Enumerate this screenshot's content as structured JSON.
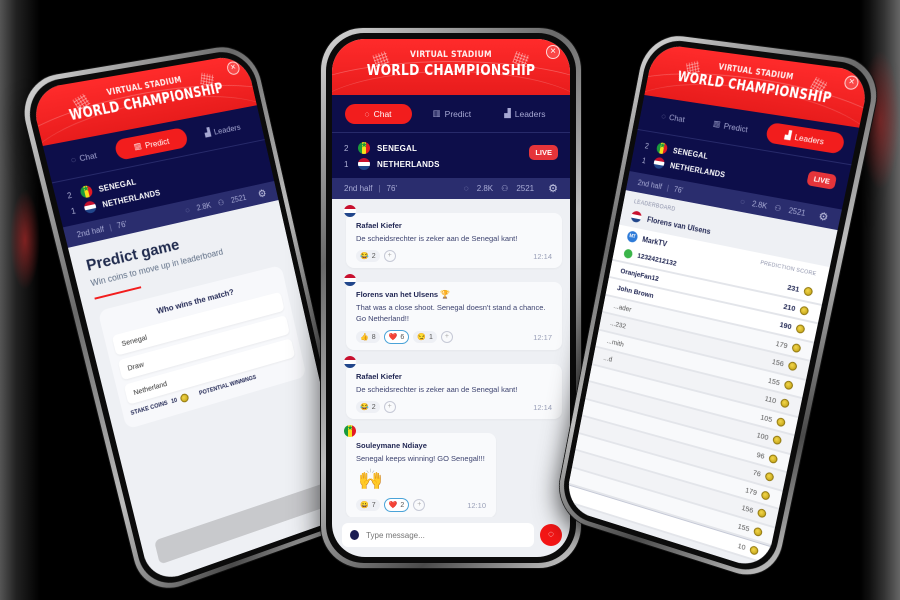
{
  "app": {
    "banner_subtitle": "VIRTUAL STADIUM",
    "banner_title": "WORLD CHAMPIONSHIP",
    "colors": {
      "primary_red": "#f21d1d",
      "navy": "#0d0e4a",
      "status_bar": "#2a2d6e",
      "live_badge": "#e5343a"
    }
  },
  "tabs": [
    {
      "label": "Chat",
      "icon": "chat-bubble-icon"
    },
    {
      "label": "Predict",
      "icon": "predict-icon"
    },
    {
      "label": "Leaders",
      "icon": "podium-icon"
    }
  ],
  "match": {
    "home": {
      "score": "2",
      "name": "SENEGAL",
      "flag": "senegal-flag"
    },
    "away": {
      "score": "1",
      "name": "NETHERLANDS",
      "flag": "netherlands-flag"
    },
    "live_label": "LIVE",
    "period": "2nd half",
    "minute": "76'",
    "messages_count": "2.8K",
    "viewers_count": "2521"
  },
  "chat": {
    "messages": [
      {
        "author": "Rafael Kiefer",
        "flag": "netherlands-flag",
        "text": "De scheidsrechter is zeker aan de Senegal kant!",
        "reactions": [
          {
            "emoji": "😂",
            "count": "2"
          }
        ],
        "time": "12:14"
      },
      {
        "author": "Florens van het Ulsens",
        "badge": "🏆",
        "flag": "netherlands-flag",
        "text": "That was a close shoot. Senegal doesn't stand a chance. Go Netherland!!",
        "reactions": [
          {
            "emoji": "👍",
            "count": "8"
          },
          {
            "emoji": "❤️",
            "count": "6",
            "selected": true
          },
          {
            "emoji": "😏",
            "count": "1"
          }
        ],
        "time": "12:17"
      },
      {
        "author": "Rafael Kiefer",
        "flag": "netherlands-flag",
        "text": "De scheidsrechter is zeker aan de Senegal kant!",
        "reactions": [
          {
            "emoji": "😂",
            "count": "2"
          }
        ],
        "time": "12:14"
      },
      {
        "author": "Souleymane Ndiaye",
        "flag": "senegal-flag",
        "text": "Senegal keeps winning! GO Senegal!!!",
        "sticker": "🙌",
        "reactions": [
          {
            "emoji": "😀",
            "count": "7"
          },
          {
            "emoji": "❤️",
            "count": "2",
            "selected": true
          }
        ],
        "time": "12:10"
      }
    ],
    "input_placeholder": "Type message..."
  },
  "predict": {
    "title": "Predict game",
    "subtitle": "Win coins to move up in leaderboard",
    "question": "Who wins the match?",
    "options": [
      "Senegal",
      "Draw",
      "Netherland"
    ],
    "stake_label": "STAKE COINS",
    "stake_value": "10",
    "potential_label": "POTENTIAL WINNINGS"
  },
  "leaders": {
    "section_label": "LEADERBOARD",
    "me": "Florens van Ulsens",
    "header_user": "MarkTV",
    "header_user_initials": "MT",
    "score_column_label": "PREDICTION SCORE",
    "rows": [
      {
        "name": "12324212132",
        "score": "231",
        "top": true
      },
      {
        "name": "OranjeFan12",
        "score": "210",
        "top": true
      },
      {
        "name": "John Brown",
        "score": "190",
        "top": true
      },
      {
        "name": "...ader",
        "score": "179"
      },
      {
        "name": "...232",
        "score": "156"
      },
      {
        "name": "...mith",
        "score": "155"
      },
      {
        "name": "...d",
        "score": "110"
      },
      {
        "name": "",
        "score": "105"
      },
      {
        "name": "",
        "score": "100"
      },
      {
        "name": "",
        "score": "96"
      },
      {
        "name": "",
        "score": "76"
      },
      {
        "name": "",
        "score": "179"
      },
      {
        "name": "",
        "score": "156"
      },
      {
        "name": "",
        "score": "155"
      },
      {
        "name": "",
        "score": "10",
        "self": true
      }
    ]
  }
}
